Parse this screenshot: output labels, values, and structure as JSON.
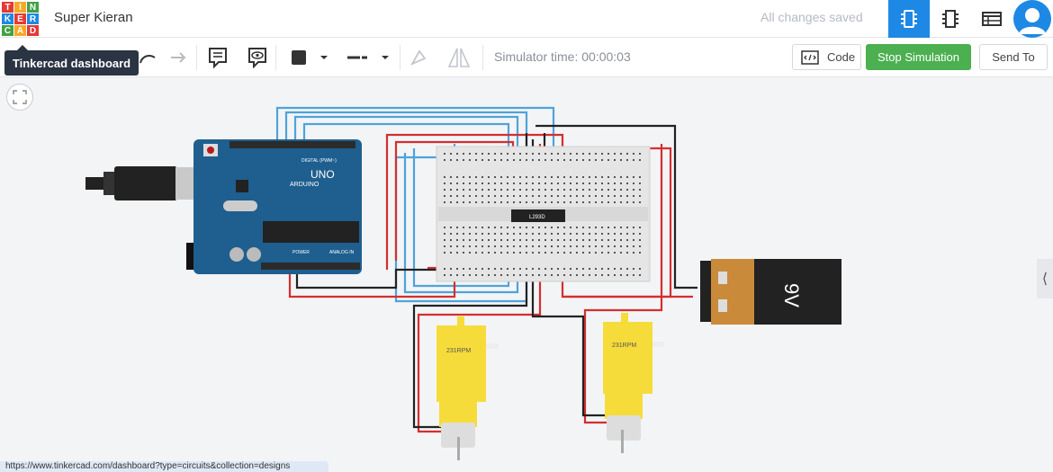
{
  "header": {
    "logo_letters": [
      "T",
      "I",
      "N",
      "K",
      "E",
      "R",
      "C",
      "A",
      "D"
    ],
    "project_title": "Super Kieran",
    "save_status": "All changes saved",
    "views": [
      "circuit-view-icon",
      "component-list-icon",
      "schematic-view-icon"
    ],
    "avatar": "user-avatar"
  },
  "toolbar": {
    "tooltip": "Tinkercad dashboard",
    "simulator_time": "Simulator time: 00:00:03",
    "code_label": "Code",
    "stop_label": "Stop Simulation",
    "send_label": "Send To"
  },
  "circuit": {
    "arduino_brand": "ARDUINO",
    "arduino_model": "UNO",
    "arduino_digital": "DIGITAL (PWM~)",
    "arduino_power": "POWER",
    "arduino_analog": "ANALOG IN",
    "chip_label": "L293D",
    "battery_label": "9V",
    "motor1_label": "231RPM",
    "motor2_label": "231RPM"
  },
  "status_bar": {
    "url": "https://www.tinkercad.com/dashboard?type=circuits&collection=designs"
  },
  "colors": {
    "accent": "#1e88e5",
    "stop_green": "#4caf50",
    "arduino_blue": "#1f5f8f",
    "wire_red": "#d32f2f",
    "wire_black": "#222222",
    "wire_blue": "#4fa3d9",
    "motor_yellow": "#f6dc3a"
  }
}
